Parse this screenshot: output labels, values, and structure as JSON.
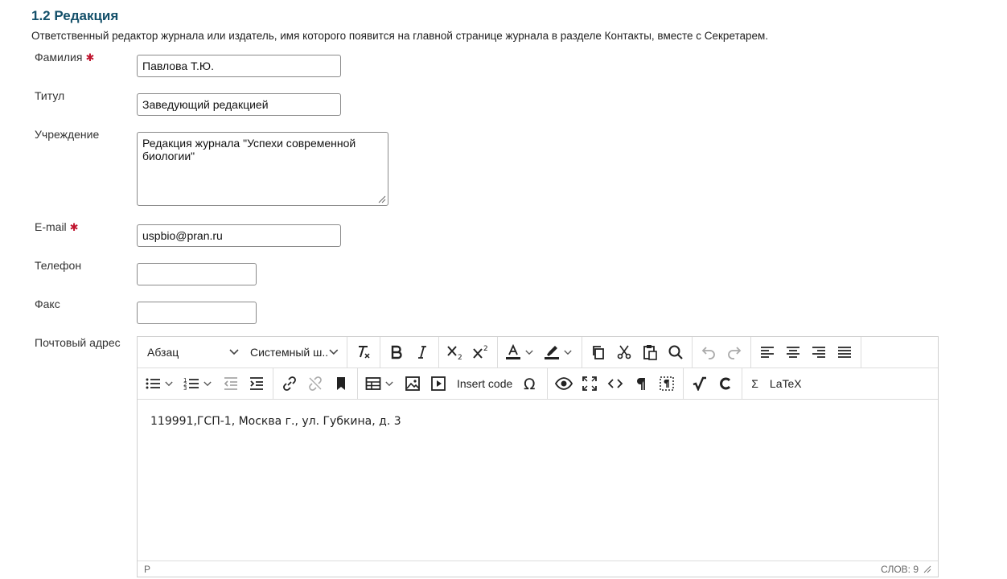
{
  "section": {
    "title": "1.2 Редакция",
    "description": "Ответственный редактор журнала или издатель, имя которого появится на главной странице журнала в разделе Контакты, вместе с Секретарем."
  },
  "fields": {
    "surname": {
      "label": "Фамилия",
      "value": "Павлова Т.Ю.",
      "required": true
    },
    "title": {
      "label": "Титул",
      "value": "Заведующий редакцией"
    },
    "institution": {
      "label": "Учреждение",
      "value": "Редакция журнала \"Успехи современной биологии\""
    },
    "email": {
      "label": "E-mail",
      "value": "uspbio@pran.ru",
      "required": true
    },
    "phone": {
      "label": "Телефон",
      "value": ""
    },
    "fax": {
      "label": "Факс",
      "value": ""
    },
    "postal": {
      "label": "Почтовый адрес"
    }
  },
  "editor": {
    "block_format": "Абзац",
    "font_family": "Системный ш...",
    "insert_code_label": "Insert code",
    "sigma_label": "Σ",
    "latex_label": "LaTeX",
    "content": "119991,ГСП-1, Москва г., ул. Губкина, д. 3",
    "status_path": "P",
    "word_count": "СЛОВ: 9",
    "icons": [
      "clear-formatting-icon",
      "bold-icon",
      "italic-icon",
      "subscript-icon",
      "superscript-icon",
      "text-color-icon",
      "highlight-color-icon",
      "copy-icon",
      "cut-icon",
      "paste-icon",
      "find-icon",
      "undo-icon",
      "redo-icon",
      "align-left-icon",
      "align-center-icon",
      "align-right-icon",
      "justify-icon",
      "bullet-list-icon",
      "numbered-list-icon",
      "outdent-icon",
      "indent-icon",
      "link-icon",
      "unlink-icon",
      "bookmark-icon",
      "table-icon",
      "image-icon",
      "media-icon",
      "omega-icon",
      "preview-icon",
      "fullscreen-icon",
      "source-code-icon",
      "paragraph-marks-icon",
      "show-blocks-icon",
      "sqrt-icon",
      "chemistry-icon"
    ]
  },
  "colors": {
    "title": "#14506a",
    "required": "#c0152f",
    "text_color_bar": "#222222"
  }
}
